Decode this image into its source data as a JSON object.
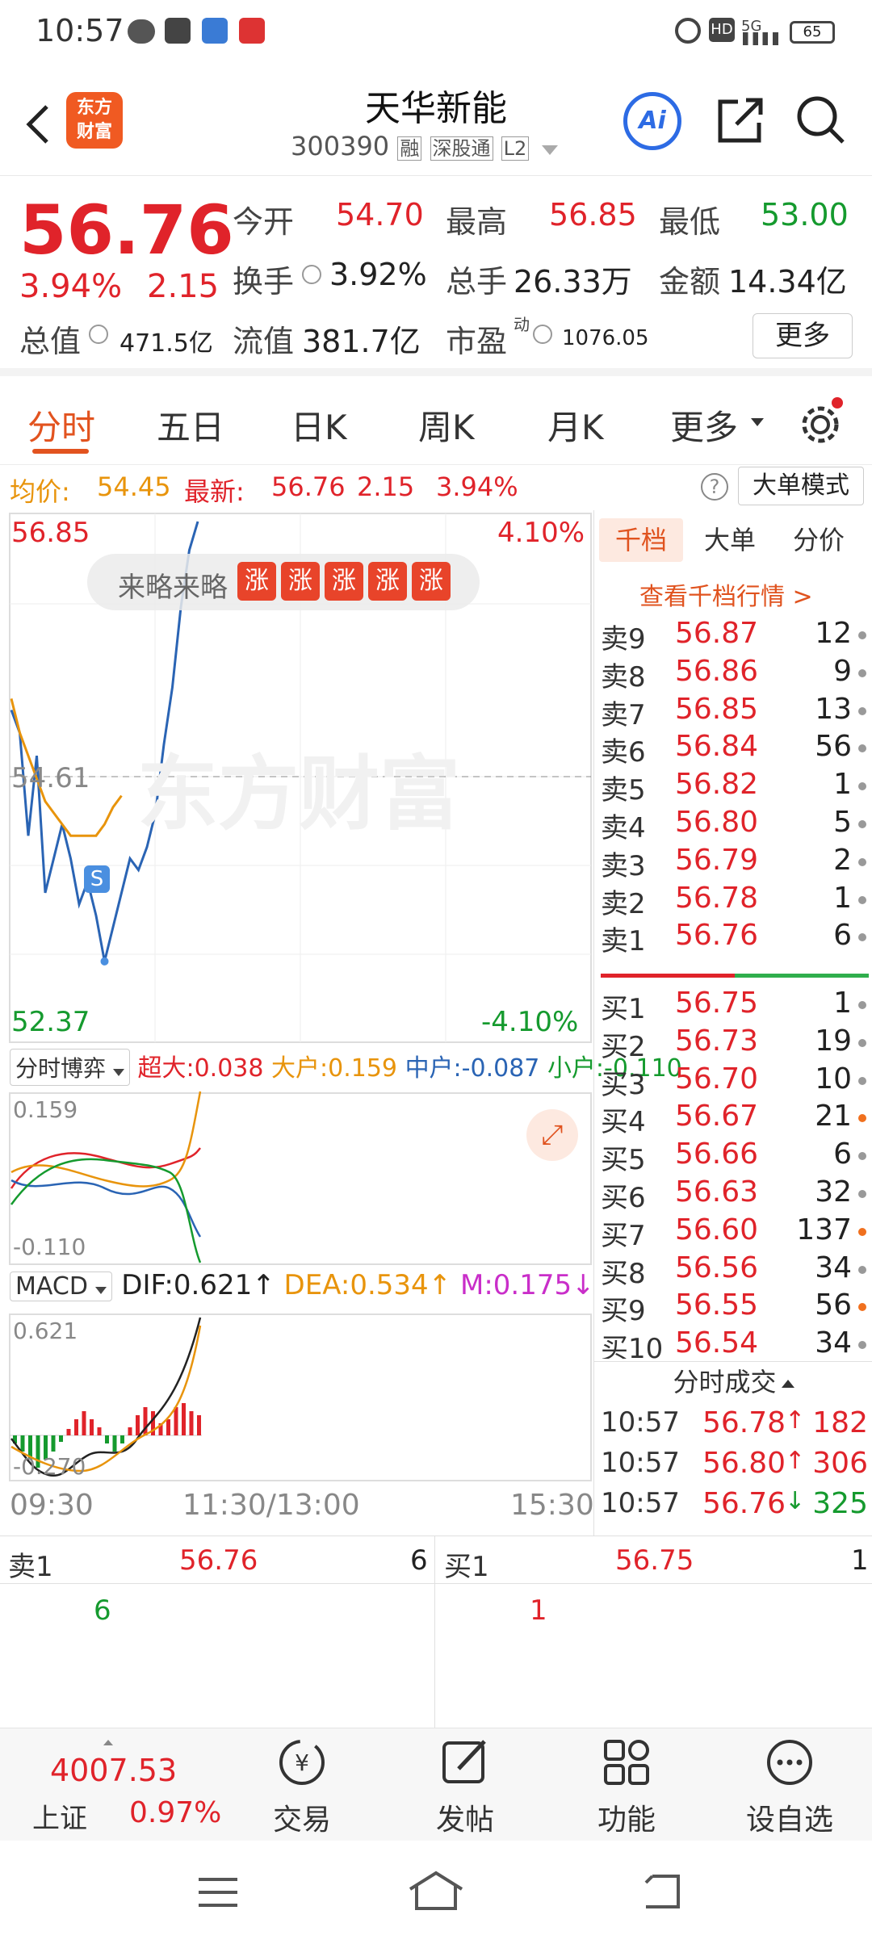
{
  "status_bar": {
    "time": "10:57",
    "net": "5G",
    "battery": "65"
  },
  "header": {
    "title": "天华新能",
    "code": "300390",
    "tags": [
      "融",
      "深股通",
      "L2"
    ],
    "logo_line1": "东方",
    "logo_line2": "财富",
    "ai_label": "Ai"
  },
  "quote": {
    "price": "56.76",
    "change_pct": "3.94%",
    "change": "2.15",
    "open_label": "今开",
    "open": "54.70",
    "high_label": "最高",
    "high": "56.85",
    "low_label": "最低",
    "low": "53.00",
    "turnover_label": "换手",
    "turnover": "3.92%",
    "volume_label": "总手",
    "volume": "26.33万",
    "amount_label": "金额",
    "amount": "14.34亿",
    "mcap_label": "总值",
    "mcap": "471.5亿",
    "float_label": "流值",
    "float": "381.7亿",
    "pe_label": "市盈",
    "pe_sup": "动",
    "pe": "1076.05",
    "more_button": "更多"
  },
  "tabs": [
    "分时",
    "五日",
    "日K",
    "周K",
    "月K",
    "更多"
  ],
  "info_bar": {
    "avg_label": "均价:",
    "avg": "54.45",
    "latest_label": "最新:",
    "latest": "56.76",
    "chg": "2.15",
    "pct": "3.94%",
    "mode_button": "大单模式"
  },
  "chart": {
    "top_price": "56.85",
    "top_pct": "4.10%",
    "bottom_price": "52.37",
    "bottom_pct": "-4.10%",
    "ref_price": "54.61",
    "promo_text": "来略来略",
    "promo_badge": "涨",
    "watermark": "东方财富",
    "time_start": "09:30",
    "time_mid": "11:30/13:00",
    "time_end": "15:30"
  },
  "chart_data": {
    "type": "line",
    "title": "",
    "ylim": [
      52.37,
      56.85
    ],
    "reference": 54.61,
    "series": [
      {
        "values": [
          55.2,
          55.0,
          54.1,
          54.8,
          53.6,
          53.9,
          54.2,
          53.9,
          53.5,
          53.7,
          53.4,
          53.0,
          53.3,
          53.6,
          53.9,
          53.8,
          54.0,
          54.3,
          54.9,
          55.4,
          56.1,
          56.6,
          56.85
        ]
      },
      {
        "values": [
          55.3,
          55.0,
          54.8,
          54.6,
          54.4,
          54.3,
          54.2,
          54.1,
          54.1,
          54.1,
          54.1,
          54.2,
          54.35,
          54.45
        ]
      }
    ]
  },
  "sub1": {
    "selector": "分时博弈",
    "super_label": "超大:",
    "super": "0.038",
    "big_label": "大户:",
    "big": "0.159",
    "mid_label": "中户:",
    "mid": "-0.087",
    "small_label": "小户:",
    "small": "-0.110",
    "top": "0.159",
    "bottom": "-0.110"
  },
  "macd": {
    "selector": "MACD",
    "dif_label": "DIF:",
    "dif": "0.621",
    "dea_label": "DEA:",
    "dea": "0.534",
    "m_label": "M:",
    "m": "0.175",
    "top": "0.621",
    "bottom": "-0.270"
  },
  "orderbook": {
    "tabs": [
      "千档",
      "大单",
      "分价"
    ],
    "link": "查看千档行情 >",
    "asks": [
      {
        "label": "卖9",
        "price": "56.87",
        "vol": "12"
      },
      {
        "label": "卖8",
        "price": "56.86",
        "vol": "9"
      },
      {
        "label": "卖7",
        "price": "56.85",
        "vol": "13"
      },
      {
        "label": "卖6",
        "price": "56.84",
        "vol": "56"
      },
      {
        "label": "卖5",
        "price": "56.82",
        "vol": "1"
      },
      {
        "label": "卖4",
        "price": "56.80",
        "vol": "5"
      },
      {
        "label": "卖3",
        "price": "56.79",
        "vol": "2"
      },
      {
        "label": "卖2",
        "price": "56.78",
        "vol": "1"
      },
      {
        "label": "卖1",
        "price": "56.76",
        "vol": "6"
      }
    ],
    "bids": [
      {
        "label": "买1",
        "price": "56.75",
        "vol": "1"
      },
      {
        "label": "买2",
        "price": "56.73",
        "vol": "19"
      },
      {
        "label": "买3",
        "price": "56.70",
        "vol": "10"
      },
      {
        "label": "买4",
        "price": "56.67",
        "vol": "21"
      },
      {
        "label": "买5",
        "price": "56.66",
        "vol": "6"
      },
      {
        "label": "买6",
        "price": "56.63",
        "vol": "32"
      },
      {
        "label": "买7",
        "price": "56.60",
        "vol": "137"
      },
      {
        "label": "买8",
        "price": "56.56",
        "vol": "34"
      },
      {
        "label": "买9",
        "price": "56.55",
        "vol": "56"
      },
      {
        "label": "买10",
        "price": "56.54",
        "vol": "34"
      }
    ],
    "trades_title": "分时成交",
    "trades": [
      {
        "time": "10:57",
        "price": "56.78",
        "arrow": "↑",
        "vol": "182"
      },
      {
        "time": "10:57",
        "price": "56.80",
        "arrow": "↑",
        "vol": "306"
      },
      {
        "time": "10:57",
        "price": "56.76",
        "arrow": "↓",
        "vol": "325"
      }
    ]
  },
  "bidask": {
    "sell_label": "卖1",
    "sell_price": "56.76",
    "sell_vol": "6",
    "sell_queue": "6",
    "buy_label": "买1",
    "buy_price": "56.75",
    "buy_vol": "1",
    "buy_queue": "1"
  },
  "bottom_nav": {
    "index_value": "4007.53",
    "index_name": "上证",
    "index_pct": "0.97%",
    "items": [
      "交易",
      "发帖",
      "功能",
      "设自选"
    ]
  }
}
